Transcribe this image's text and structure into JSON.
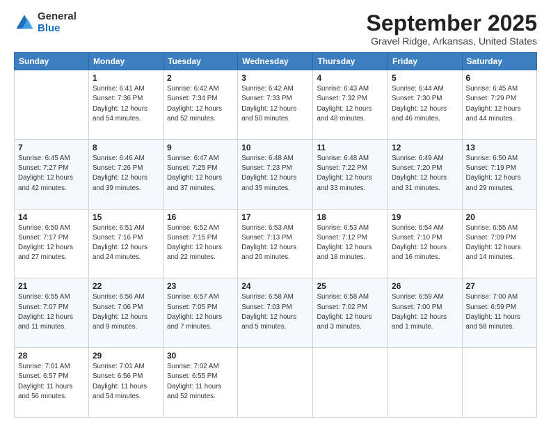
{
  "logo": {
    "general": "General",
    "blue": "Blue"
  },
  "header": {
    "title": "September 2025",
    "location": "Gravel Ridge, Arkansas, United States"
  },
  "days_of_week": [
    "Sunday",
    "Monday",
    "Tuesday",
    "Wednesday",
    "Thursday",
    "Friday",
    "Saturday"
  ],
  "weeks": [
    [
      {
        "day": "",
        "sunrise": "",
        "sunset": "",
        "daylight": ""
      },
      {
        "day": "1",
        "sunrise": "Sunrise: 6:41 AM",
        "sunset": "Sunset: 7:36 PM",
        "daylight": "Daylight: 12 hours and 54 minutes."
      },
      {
        "day": "2",
        "sunrise": "Sunrise: 6:42 AM",
        "sunset": "Sunset: 7:34 PM",
        "daylight": "Daylight: 12 hours and 52 minutes."
      },
      {
        "day": "3",
        "sunrise": "Sunrise: 6:42 AM",
        "sunset": "Sunset: 7:33 PM",
        "daylight": "Daylight: 12 hours and 50 minutes."
      },
      {
        "day": "4",
        "sunrise": "Sunrise: 6:43 AM",
        "sunset": "Sunset: 7:32 PM",
        "daylight": "Daylight: 12 hours and 48 minutes."
      },
      {
        "day": "5",
        "sunrise": "Sunrise: 6:44 AM",
        "sunset": "Sunset: 7:30 PM",
        "daylight": "Daylight: 12 hours and 46 minutes."
      },
      {
        "day": "6",
        "sunrise": "Sunrise: 6:45 AM",
        "sunset": "Sunset: 7:29 PM",
        "daylight": "Daylight: 12 hours and 44 minutes."
      }
    ],
    [
      {
        "day": "7",
        "sunrise": "Sunrise: 6:45 AM",
        "sunset": "Sunset: 7:27 PM",
        "daylight": "Daylight: 12 hours and 42 minutes."
      },
      {
        "day": "8",
        "sunrise": "Sunrise: 6:46 AM",
        "sunset": "Sunset: 7:26 PM",
        "daylight": "Daylight: 12 hours and 39 minutes."
      },
      {
        "day": "9",
        "sunrise": "Sunrise: 6:47 AM",
        "sunset": "Sunset: 7:25 PM",
        "daylight": "Daylight: 12 hours and 37 minutes."
      },
      {
        "day": "10",
        "sunrise": "Sunrise: 6:48 AM",
        "sunset": "Sunset: 7:23 PM",
        "daylight": "Daylight: 12 hours and 35 minutes."
      },
      {
        "day": "11",
        "sunrise": "Sunrise: 6:48 AM",
        "sunset": "Sunset: 7:22 PM",
        "daylight": "Daylight: 12 hours and 33 minutes."
      },
      {
        "day": "12",
        "sunrise": "Sunrise: 6:49 AM",
        "sunset": "Sunset: 7:20 PM",
        "daylight": "Daylight: 12 hours and 31 minutes."
      },
      {
        "day": "13",
        "sunrise": "Sunrise: 6:50 AM",
        "sunset": "Sunset: 7:19 PM",
        "daylight": "Daylight: 12 hours and 29 minutes."
      }
    ],
    [
      {
        "day": "14",
        "sunrise": "Sunrise: 6:50 AM",
        "sunset": "Sunset: 7:17 PM",
        "daylight": "Daylight: 12 hours and 27 minutes."
      },
      {
        "day": "15",
        "sunrise": "Sunrise: 6:51 AM",
        "sunset": "Sunset: 7:16 PM",
        "daylight": "Daylight: 12 hours and 24 minutes."
      },
      {
        "day": "16",
        "sunrise": "Sunrise: 6:52 AM",
        "sunset": "Sunset: 7:15 PM",
        "daylight": "Daylight: 12 hours and 22 minutes."
      },
      {
        "day": "17",
        "sunrise": "Sunrise: 6:53 AM",
        "sunset": "Sunset: 7:13 PM",
        "daylight": "Daylight: 12 hours and 20 minutes."
      },
      {
        "day": "18",
        "sunrise": "Sunrise: 6:53 AM",
        "sunset": "Sunset: 7:12 PM",
        "daylight": "Daylight: 12 hours and 18 minutes."
      },
      {
        "day": "19",
        "sunrise": "Sunrise: 6:54 AM",
        "sunset": "Sunset: 7:10 PM",
        "daylight": "Daylight: 12 hours and 16 minutes."
      },
      {
        "day": "20",
        "sunrise": "Sunrise: 6:55 AM",
        "sunset": "Sunset: 7:09 PM",
        "daylight": "Daylight: 12 hours and 14 minutes."
      }
    ],
    [
      {
        "day": "21",
        "sunrise": "Sunrise: 6:55 AM",
        "sunset": "Sunset: 7:07 PM",
        "daylight": "Daylight: 12 hours and 11 minutes."
      },
      {
        "day": "22",
        "sunrise": "Sunrise: 6:56 AM",
        "sunset": "Sunset: 7:06 PM",
        "daylight": "Daylight: 12 hours and 9 minutes."
      },
      {
        "day": "23",
        "sunrise": "Sunrise: 6:57 AM",
        "sunset": "Sunset: 7:05 PM",
        "daylight": "Daylight: 12 hours and 7 minutes."
      },
      {
        "day": "24",
        "sunrise": "Sunrise: 6:58 AM",
        "sunset": "Sunset: 7:03 PM",
        "daylight": "Daylight: 12 hours and 5 minutes."
      },
      {
        "day": "25",
        "sunrise": "Sunrise: 6:58 AM",
        "sunset": "Sunset: 7:02 PM",
        "daylight": "Daylight: 12 hours and 3 minutes."
      },
      {
        "day": "26",
        "sunrise": "Sunrise: 6:59 AM",
        "sunset": "Sunset: 7:00 PM",
        "daylight": "Daylight: 12 hours and 1 minute."
      },
      {
        "day": "27",
        "sunrise": "Sunrise: 7:00 AM",
        "sunset": "Sunset: 6:59 PM",
        "daylight": "Daylight: 11 hours and 58 minutes."
      }
    ],
    [
      {
        "day": "28",
        "sunrise": "Sunrise: 7:01 AM",
        "sunset": "Sunset: 6:57 PM",
        "daylight": "Daylight: 11 hours and 56 minutes."
      },
      {
        "day": "29",
        "sunrise": "Sunrise: 7:01 AM",
        "sunset": "Sunset: 6:56 PM",
        "daylight": "Daylight: 11 hours and 54 minutes."
      },
      {
        "day": "30",
        "sunrise": "Sunrise: 7:02 AM",
        "sunset": "Sunset: 6:55 PM",
        "daylight": "Daylight: 11 hours and 52 minutes."
      },
      {
        "day": "",
        "sunrise": "",
        "sunset": "",
        "daylight": ""
      },
      {
        "day": "",
        "sunrise": "",
        "sunset": "",
        "daylight": ""
      },
      {
        "day": "",
        "sunrise": "",
        "sunset": "",
        "daylight": ""
      },
      {
        "day": "",
        "sunrise": "",
        "sunset": "",
        "daylight": ""
      }
    ]
  ]
}
